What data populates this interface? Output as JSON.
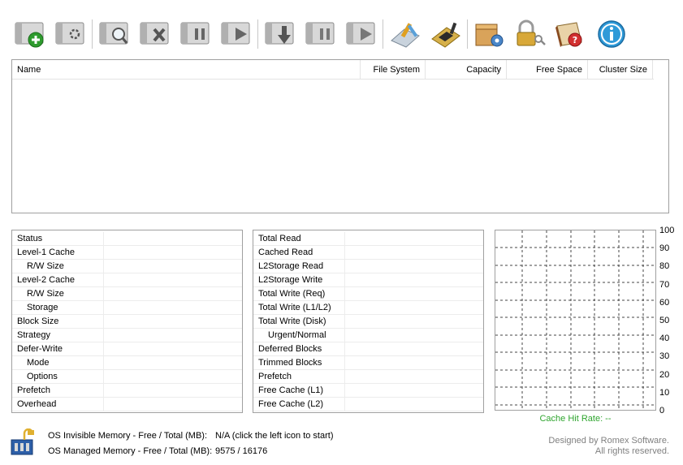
{
  "toolbar": {
    "buttons": [
      {
        "name": "add-cache-icon"
      },
      {
        "name": "cache-options-icon"
      },
      {
        "name": "find-cache-icon"
      },
      {
        "name": "remove-cache-icon"
      },
      {
        "name": "pause-cache-icon"
      },
      {
        "name": "resume-cache-icon"
      },
      {
        "name": "flush-cache-icon"
      },
      {
        "name": "pause-all-icon"
      },
      {
        "name": "resume-all-icon"
      },
      {
        "name": "tools-icon"
      },
      {
        "name": "chip-icon"
      },
      {
        "name": "settings-icon"
      },
      {
        "name": "license-icon"
      },
      {
        "name": "help-icon"
      },
      {
        "name": "info-icon"
      }
    ]
  },
  "volume_list": {
    "columns": {
      "name": "Name",
      "file_system": "File System",
      "capacity": "Capacity",
      "free_space": "Free Space",
      "cluster_size": "Cluster Size"
    }
  },
  "left_panel": [
    {
      "label": "Status",
      "indent": false
    },
    {
      "label": "Level-1 Cache",
      "indent": false
    },
    {
      "label": "R/W Size",
      "indent": true
    },
    {
      "label": "Level-2 Cache",
      "indent": false
    },
    {
      "label": "R/W Size",
      "indent": true
    },
    {
      "label": "Storage",
      "indent": true
    },
    {
      "label": "Block Size",
      "indent": false
    },
    {
      "label": "Strategy",
      "indent": false
    },
    {
      "label": "Defer-Write",
      "indent": false
    },
    {
      "label": "Mode",
      "indent": true
    },
    {
      "label": "Options",
      "indent": true
    },
    {
      "label": "Prefetch",
      "indent": false
    },
    {
      "label": "Overhead",
      "indent": false
    }
  ],
  "mid_panel": [
    {
      "label": "Total Read",
      "indent": false
    },
    {
      "label": "Cached Read",
      "indent": false
    },
    {
      "label": "L2Storage Read",
      "indent": false
    },
    {
      "label": "L2Storage Write",
      "indent": false
    },
    {
      "label": "Total Write (Req)",
      "indent": false
    },
    {
      "label": "Total Write (L1/L2)",
      "indent": false
    },
    {
      "label": "Total Write (Disk)",
      "indent": false
    },
    {
      "label": "Urgent/Normal",
      "indent": true
    },
    {
      "label": "Deferred Blocks",
      "indent": false
    },
    {
      "label": "Trimmed Blocks",
      "indent": false
    },
    {
      "label": "Prefetch",
      "indent": false
    },
    {
      "label": "Free Cache (L1)",
      "indent": false
    },
    {
      "label": "Free Cache (L2)",
      "indent": false
    }
  ],
  "chart": {
    "y_ticks": [
      "100",
      "90",
      "80",
      "70",
      "60",
      "50",
      "40",
      "30",
      "20",
      "10",
      "0"
    ],
    "caption": "Cache Hit Rate: --",
    "caption_color": "#2fa52f"
  },
  "footer": {
    "invisible_label": "OS Invisible Memory - Free / Total (MB):",
    "invisible_value": "N/A (click the left icon to start)",
    "managed_label": "OS Managed Memory - Free / Total (MB):",
    "managed_value": "9575 / 16176",
    "credits_line1": "Designed by Romex Software.",
    "credits_line2": "All rights reserved."
  }
}
